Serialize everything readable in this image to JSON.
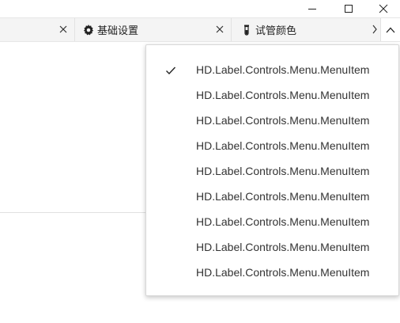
{
  "window": {
    "controls": {
      "minimize_icon": "minimize-icon",
      "maximize_icon": "maximize-icon",
      "close_icon": "close-icon"
    }
  },
  "tabs": [
    {
      "label": "",
      "icon": "",
      "closable": true
    },
    {
      "label": "基础设置",
      "icon": "gear-icon",
      "closable": true
    },
    {
      "label": "试管颜色",
      "icon": "test-tube-icon",
      "closable": false
    }
  ],
  "tab_overflow": {
    "icon": "chevron-up-icon",
    "expanded": true
  },
  "menu": {
    "selected_index": 0,
    "items": [
      {
        "label": "HD.Label.Controls.Menu.MenuItem",
        "checked": true
      },
      {
        "label": "HD.Label.Controls.Menu.MenuItem",
        "checked": false
      },
      {
        "label": "HD.Label.Controls.Menu.MenuItem",
        "checked": false
      },
      {
        "label": "HD.Label.Controls.Menu.MenuItem",
        "checked": false
      },
      {
        "label": "HD.Label.Controls.Menu.MenuItem",
        "checked": false
      },
      {
        "label": "HD.Label.Controls.Menu.MenuItem",
        "checked": false
      },
      {
        "label": "HD.Label.Controls.Menu.MenuItem",
        "checked": false
      },
      {
        "label": "HD.Label.Controls.Menu.MenuItem",
        "checked": false
      },
      {
        "label": "HD.Label.Controls.Menu.MenuItem",
        "checked": false
      }
    ]
  },
  "colors": {
    "tabbar_bg": "#f4f4f4",
    "text": "#222222",
    "menu_text": "#333333",
    "border": "#d8d8d8"
  }
}
